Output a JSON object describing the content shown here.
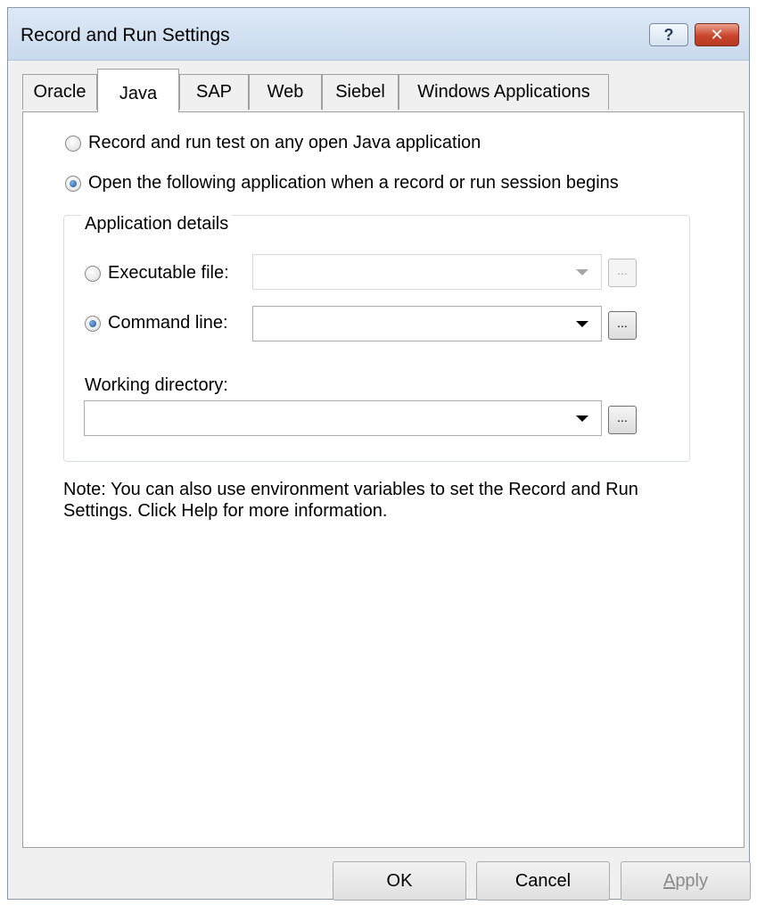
{
  "window": {
    "title": "Record and Run Settings",
    "help_label": "?",
    "close_label": "✕"
  },
  "tabs": [
    {
      "label": "Oracle",
      "active": false
    },
    {
      "label": "Java",
      "active": true
    },
    {
      "label": "SAP",
      "active": false
    },
    {
      "label": "Web",
      "active": false
    },
    {
      "label": "Siebel",
      "active": false
    },
    {
      "label": "Windows Applications",
      "active": false
    }
  ],
  "options": {
    "any_open": {
      "label": "Record and run test on any open Java application",
      "checked": false
    },
    "open_following": {
      "label": "Open the following application when a record or run session begins",
      "checked": true
    }
  },
  "app_details": {
    "legend": "Application details",
    "executable": {
      "label": "Executable file:",
      "checked": false,
      "value": "",
      "enabled": false
    },
    "command_line": {
      "label": "Command line:",
      "checked": true,
      "value": "",
      "enabled": true
    },
    "working_directory": {
      "label": "Working directory:",
      "value": ""
    },
    "browse_label": "..."
  },
  "note": "Note: You can also use environment variables to set the Record and Run Settings.  Click Help for more information.",
  "buttons": {
    "ok": "OK",
    "cancel": "Cancel",
    "apply_accel": "A",
    "apply_rest": "pply"
  },
  "colors": {
    "accent_radio": "#1c4f98",
    "close_button": "#c9442a"
  }
}
